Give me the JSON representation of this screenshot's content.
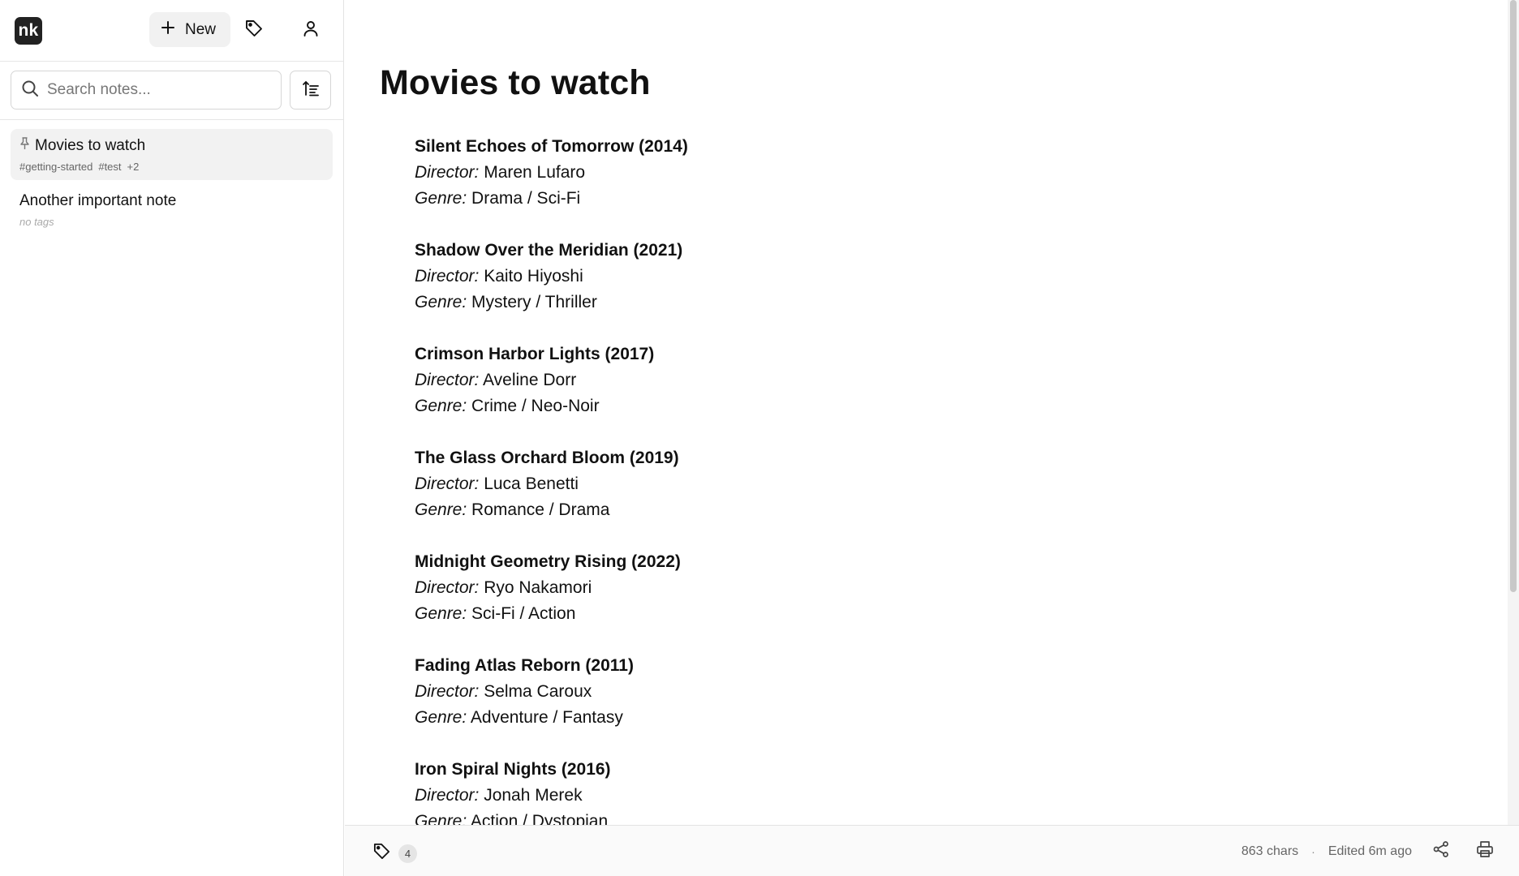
{
  "app": {
    "logo_text": "nk"
  },
  "toolbar": {
    "new_label": "New"
  },
  "search": {
    "placeholder": "Search notes..."
  },
  "notes": [
    {
      "title": "Movies to watch",
      "pinned": true,
      "tags": [
        "#getting-started",
        "#test"
      ],
      "more_tags": "+2",
      "active": true
    },
    {
      "title": "Another important note",
      "pinned": false,
      "tags": [],
      "empty_tags_label": "no tags"
    }
  ],
  "editor": {
    "title": "Movies to watch",
    "director_label": "Director:",
    "genre_label": "Genre:",
    "movies": [
      {
        "title": "Silent Echoes of Tomorrow (2014)",
        "director": "Maren Lufaro",
        "genre": "Drama / Sci-Fi"
      },
      {
        "title": "Shadow Over the Meridian (2021)",
        "director": "Kaito Hiyoshi",
        "genre": "Mystery / Thriller"
      },
      {
        "title": "Crimson Harbor Lights (2017)",
        "director": "Aveline Dorr",
        "genre": "Crime / Neo-Noir"
      },
      {
        "title": "The Glass Orchard Bloom (2019)",
        "director": "Luca Benetti",
        "genre": "Romance / Drama"
      },
      {
        "title": "Midnight Geometry Rising (2022)",
        "director": "Ryo Nakamori",
        "genre": "Sci-Fi / Action"
      },
      {
        "title": "Fading Atlas Reborn (2011)",
        "director": "Selma Caroux",
        "genre": "Adventure / Fantasy"
      },
      {
        "title": "Iron Spiral Nights (2016)",
        "director": "Jonah Merek",
        "genre": "Action / Dystopian"
      }
    ]
  },
  "footer": {
    "tag_count": "4",
    "chars": "863 chars",
    "separator": "·",
    "edited": "Edited 6m ago"
  },
  "icons": {
    "new": "plus-icon",
    "tags": "tag-icon",
    "account": "user-icon",
    "search": "search-icon",
    "sort": "sort-icon",
    "pin": "pin-icon",
    "share": "share-icon",
    "print": "print-icon"
  }
}
